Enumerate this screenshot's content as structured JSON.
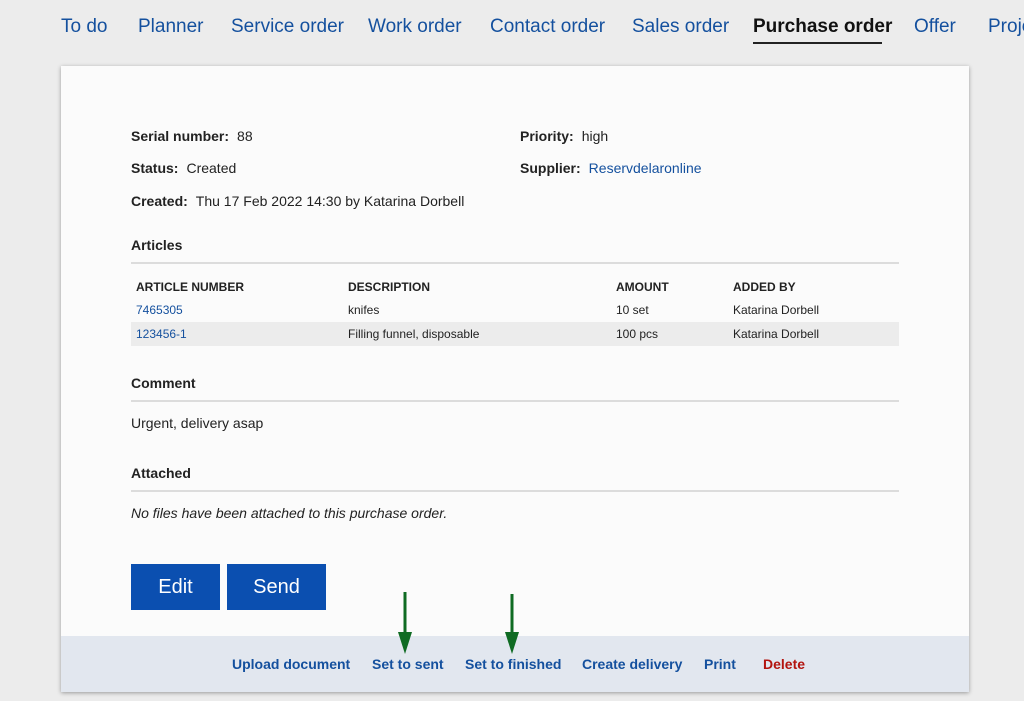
{
  "nav": {
    "tabs": [
      {
        "label": "To do"
      },
      {
        "label": "Planner"
      },
      {
        "label": "Service order"
      },
      {
        "label": "Work order"
      },
      {
        "label": "Contact order"
      },
      {
        "label": "Sales order"
      },
      {
        "label": "Purchase order",
        "active": true
      },
      {
        "label": "Offer"
      },
      {
        "label": "Proje"
      }
    ]
  },
  "order": {
    "serial_label": "Serial number:",
    "serial_value": "88",
    "status_label": "Status:",
    "status_value": "Created",
    "created_label": "Created:",
    "created_value": "Thu 17 Feb 2022 14:30 by Katarina Dorbell",
    "priority_label": "Priority:",
    "priority_value": "high",
    "supplier_label": "Supplier:",
    "supplier_value": "Reservdelaronline"
  },
  "articles": {
    "title": "Articles",
    "columns": [
      "ARTICLE NUMBER",
      "DESCRIPTION",
      "AMOUNT",
      "ADDED BY"
    ],
    "rows": [
      {
        "number": "7465305",
        "description": "knifes",
        "amount": "10 set",
        "added_by": "Katarina Dorbell"
      },
      {
        "number": "123456-1",
        "description": "Filling funnel, disposable",
        "amount": "100 pcs",
        "added_by": "Katarina Dorbell"
      }
    ]
  },
  "comment": {
    "title": "Comment",
    "text": "Urgent, delivery asap"
  },
  "attached": {
    "title": "Attached",
    "text": "No files have been attached to this purchase order."
  },
  "buttons": {
    "edit": "Edit",
    "send": "Send"
  },
  "footer": {
    "upload": "Upload document",
    "set_sent": "Set to sent",
    "set_finished": "Set to finished",
    "create_delivery": "Create delivery",
    "print": "Print",
    "delete": "Delete"
  },
  "colors": {
    "link": "#14509e",
    "button": "#0b4fb0",
    "danger": "#b3140f",
    "annotation_arrow": "#0f6b23"
  },
  "icons": {
    "annotation": "down-arrow-icon"
  }
}
